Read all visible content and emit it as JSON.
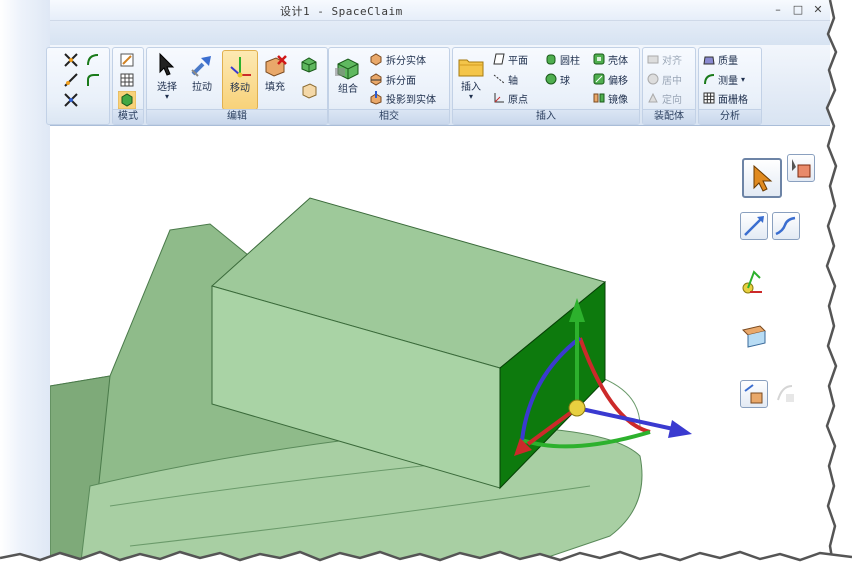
{
  "window": {
    "title": "设计1 - SpaceClaim",
    "minimize": "–",
    "maximize": "□",
    "close": "✕"
  },
  "ribbon": {
    "mode_group": {
      "label": "模式"
    },
    "edit_group": {
      "label": "编辑",
      "buttons": [
        {
          "label": "选择",
          "icon": "select-arrow-icon"
        },
        {
          "label": "拉动",
          "icon": "pull-icon"
        },
        {
          "label": "移动",
          "icon": "move-icon",
          "active": true
        },
        {
          "label": "填充",
          "icon": "fill-icon"
        }
      ]
    },
    "intersect_group": {
      "label": "相交",
      "combine_label": "组合",
      "items": [
        "拆分实体",
        "拆分面",
        "投影到实体"
      ]
    },
    "insert_group": {
      "label": "插入",
      "insert_label": "插入",
      "col1": [
        "平面",
        "轴",
        "原点"
      ],
      "col2": [
        "圆柱",
        "球"
      ],
      "col3": [
        "壳体",
        "偏移",
        "镜像"
      ]
    },
    "assembly_group": {
      "label": "装配体",
      "items": [
        "对齐",
        "居中",
        "定向"
      ]
    },
    "analysis_group": {
      "label": "分析",
      "items": [
        "质量",
        "测量",
        "面栅格"
      ]
    }
  },
  "colors": {
    "accent_active": "#f8d27a",
    "block_face_top": "#9dc79a",
    "block_face_front": "#a9d3a5",
    "block_face_side": "#0d7a0d",
    "base_body": "#94bd8e",
    "axis_green": "#2db12d",
    "axis_red": "#cc2a2a",
    "axis_blue": "#3a3ad0"
  }
}
